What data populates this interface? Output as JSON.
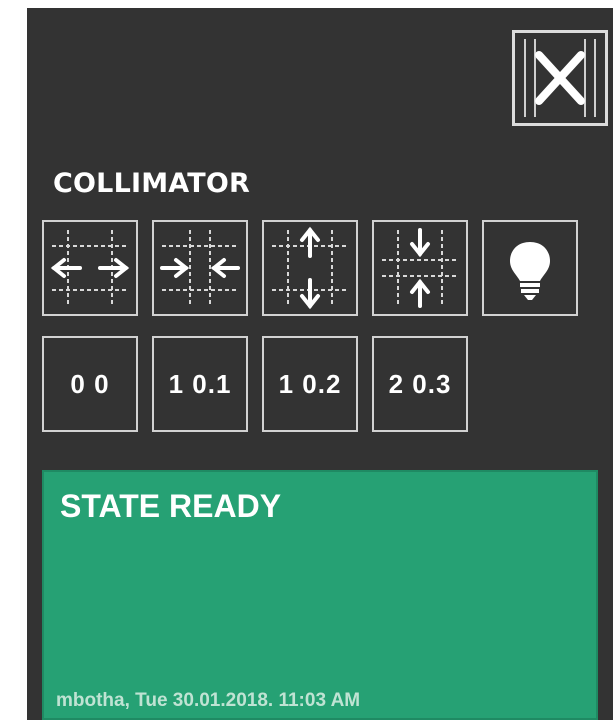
{
  "panel": {
    "close_icon": "close-x-icon",
    "section_title": "COLLIMATOR"
  },
  "collimator_buttons": [
    {
      "icon": "expand-horizontal-icon"
    },
    {
      "icon": "contract-horizontal-icon"
    },
    {
      "icon": "expand-vertical-icon"
    },
    {
      "icon": "contract-vertical-icon"
    },
    {
      "icon": "lightbulb-icon"
    }
  ],
  "value_buttons": [
    {
      "label": "0 0"
    },
    {
      "label": "1 0.1"
    },
    {
      "label": "1 0.2"
    },
    {
      "label": "2 0.3"
    }
  ],
  "state": {
    "text": "STATE READY",
    "footer": "mbotha, Tue 30.01.2018. 11:03 AM",
    "color": "#26a174"
  }
}
